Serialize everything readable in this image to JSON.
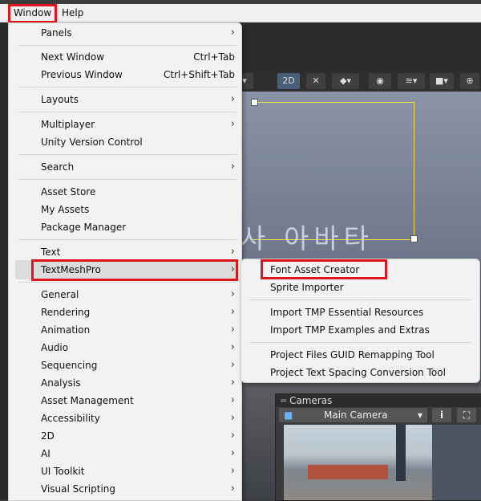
{
  "menubar": {
    "window": "Window",
    "help": "Help"
  },
  "toolbar": {
    "mode_2d": "2D"
  },
  "scene": {
    "overlay_text": "사 아바타"
  },
  "cameras": {
    "title": "Cameras",
    "selected": "Main Camera",
    "info_icon": "info-icon"
  },
  "main_menu": {
    "items": [
      {
        "label": "Panels",
        "arrow": "›"
      },
      {
        "label": "Next Window",
        "shortcut": "Ctrl+Tab"
      },
      {
        "label": "Previous Window",
        "shortcut": "Ctrl+Shift+Tab"
      },
      {
        "label": "Layouts",
        "arrow": "›"
      },
      {
        "label": "Multiplayer",
        "arrow": "›"
      },
      {
        "label": "Unity Version Control"
      },
      {
        "label": "Search",
        "arrow": "›"
      },
      {
        "label": "Asset Store"
      },
      {
        "label": "My Assets"
      },
      {
        "label": "Package Manager"
      },
      {
        "label": "Text",
        "arrow": "›"
      },
      {
        "label": "TextMeshPro",
        "arrow": "›"
      },
      {
        "label": "General",
        "arrow": "›"
      },
      {
        "label": "Rendering",
        "arrow": "›"
      },
      {
        "label": "Animation",
        "arrow": "›"
      },
      {
        "label": "Audio",
        "arrow": "›"
      },
      {
        "label": "Sequencing",
        "arrow": "›"
      },
      {
        "label": "Analysis",
        "arrow": "›"
      },
      {
        "label": "Asset Management",
        "arrow": "›"
      },
      {
        "label": "Accessibility",
        "arrow": "›"
      },
      {
        "label": "2D",
        "arrow": "›"
      },
      {
        "label": "AI",
        "arrow": "›"
      },
      {
        "label": "UI Toolkit",
        "arrow": "›"
      },
      {
        "label": "Visual Scripting",
        "arrow": "›"
      }
    ]
  },
  "sub_menu": {
    "items": [
      {
        "label": "Font Asset Creator"
      },
      {
        "label": "Sprite Importer"
      },
      {
        "label": "Import TMP Essential Resources"
      },
      {
        "label": "Import TMP Examples and Extras"
      },
      {
        "label": "Project Files GUID Remapping Tool"
      },
      {
        "label": "Project Text Spacing Conversion Tool"
      }
    ]
  },
  "colors": {
    "highlight_box": "#e0141c",
    "menu_bg": "#f2f2f2",
    "guide_yellow": "#e8e04a"
  }
}
